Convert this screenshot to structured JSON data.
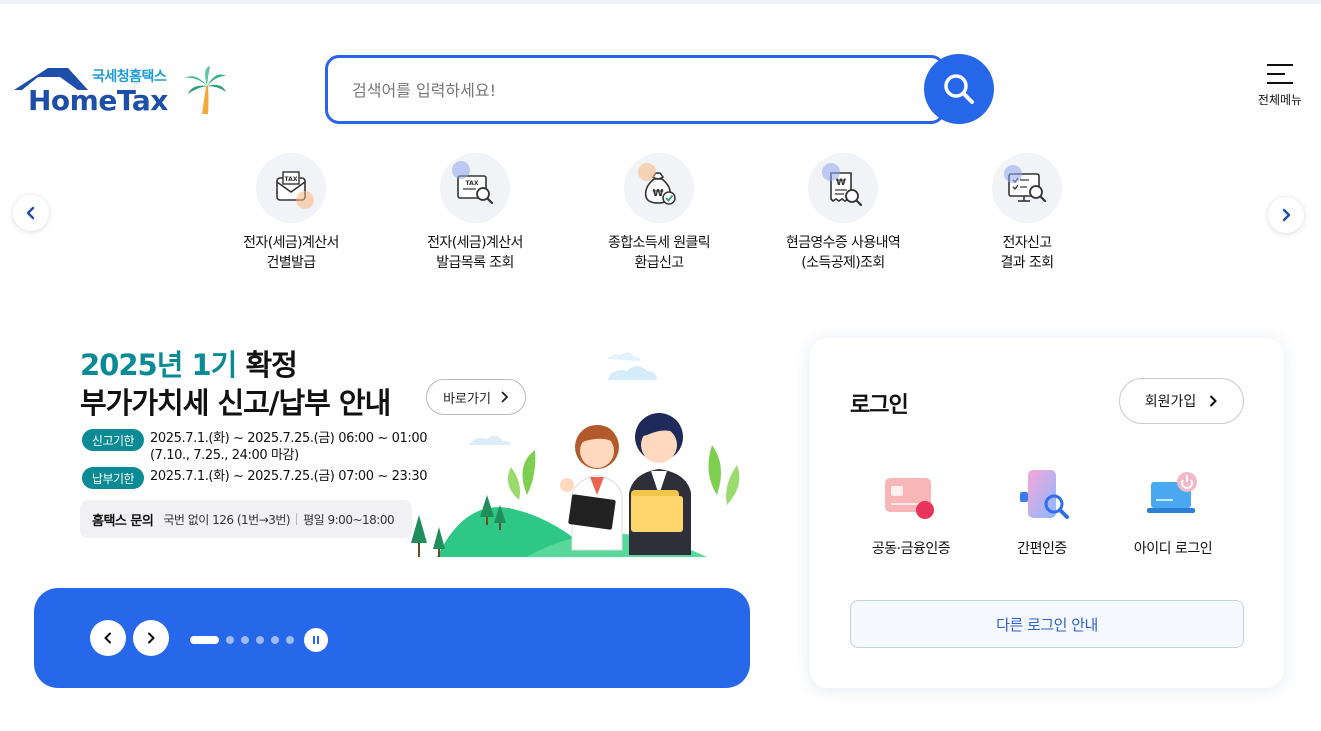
{
  "header": {
    "logo_kr": "국세청홈택스",
    "logo_en": "HomeTax",
    "search_placeholder": "검색어를 입력하세요!",
    "all_menu_label": "전체메뉴"
  },
  "quick_menu": [
    {
      "line1": "전자(세금)계산서",
      "line2": "건별발급",
      "icon": "tax-invoice-envelope-icon"
    },
    {
      "line1": "전자(세금)계산서",
      "line2": "발급목록 조회",
      "icon": "tax-invoice-search-icon"
    },
    {
      "line1": "종합소득세 원클릭",
      "line2": "환급신고",
      "icon": "money-bag-refund-icon"
    },
    {
      "line1": "현금영수증 사용내역",
      "line2": "(소득공제)조회",
      "icon": "receipt-search-icon"
    },
    {
      "line1": "전자신고",
      "line2": "결과 조회",
      "icon": "monitor-checklist-icon"
    }
  ],
  "banner": {
    "title_highlight": "2025년 1기",
    "title_rest": " 확정",
    "title_line2": "부가가치세 신고/납부 안내",
    "goto_label": "바로가기",
    "report_tag": "신고기한",
    "report_period": "2025.7.1.(화) ~ 2025.7.25.(금) 06:00 ~ 01:00",
    "report_note": "(7.10., 7.25., 24:00 마감)",
    "payment_tag": "납부기한",
    "payment_period": "2025.7.1.(화) ~ 2025.7.25.(금) 07:00 ~ 23:30",
    "inquiry_label": "홈택스 문의",
    "inquiry_phone": "국번 없이 126 (1번→3번)",
    "inquiry_hours": "평일 9:00~18:00"
  },
  "banner_controls": {
    "slide_count": 6,
    "active_slide": 1
  },
  "login": {
    "title": "로그인",
    "signup_label": "회원가입",
    "methods": [
      {
        "label": "공동·금융인증",
        "icon": "certificate-card-icon"
      },
      {
        "label": "간편인증",
        "icon": "phone-search-icon"
      },
      {
        "label": "아이디 로그인",
        "icon": "laptop-power-icon"
      }
    ],
    "other_login_label": "다른 로그인 안내"
  },
  "colors": {
    "brand_blue": "#2767e9",
    "teal": "#0a8a95",
    "logo_navy": "#1e4fa8"
  }
}
